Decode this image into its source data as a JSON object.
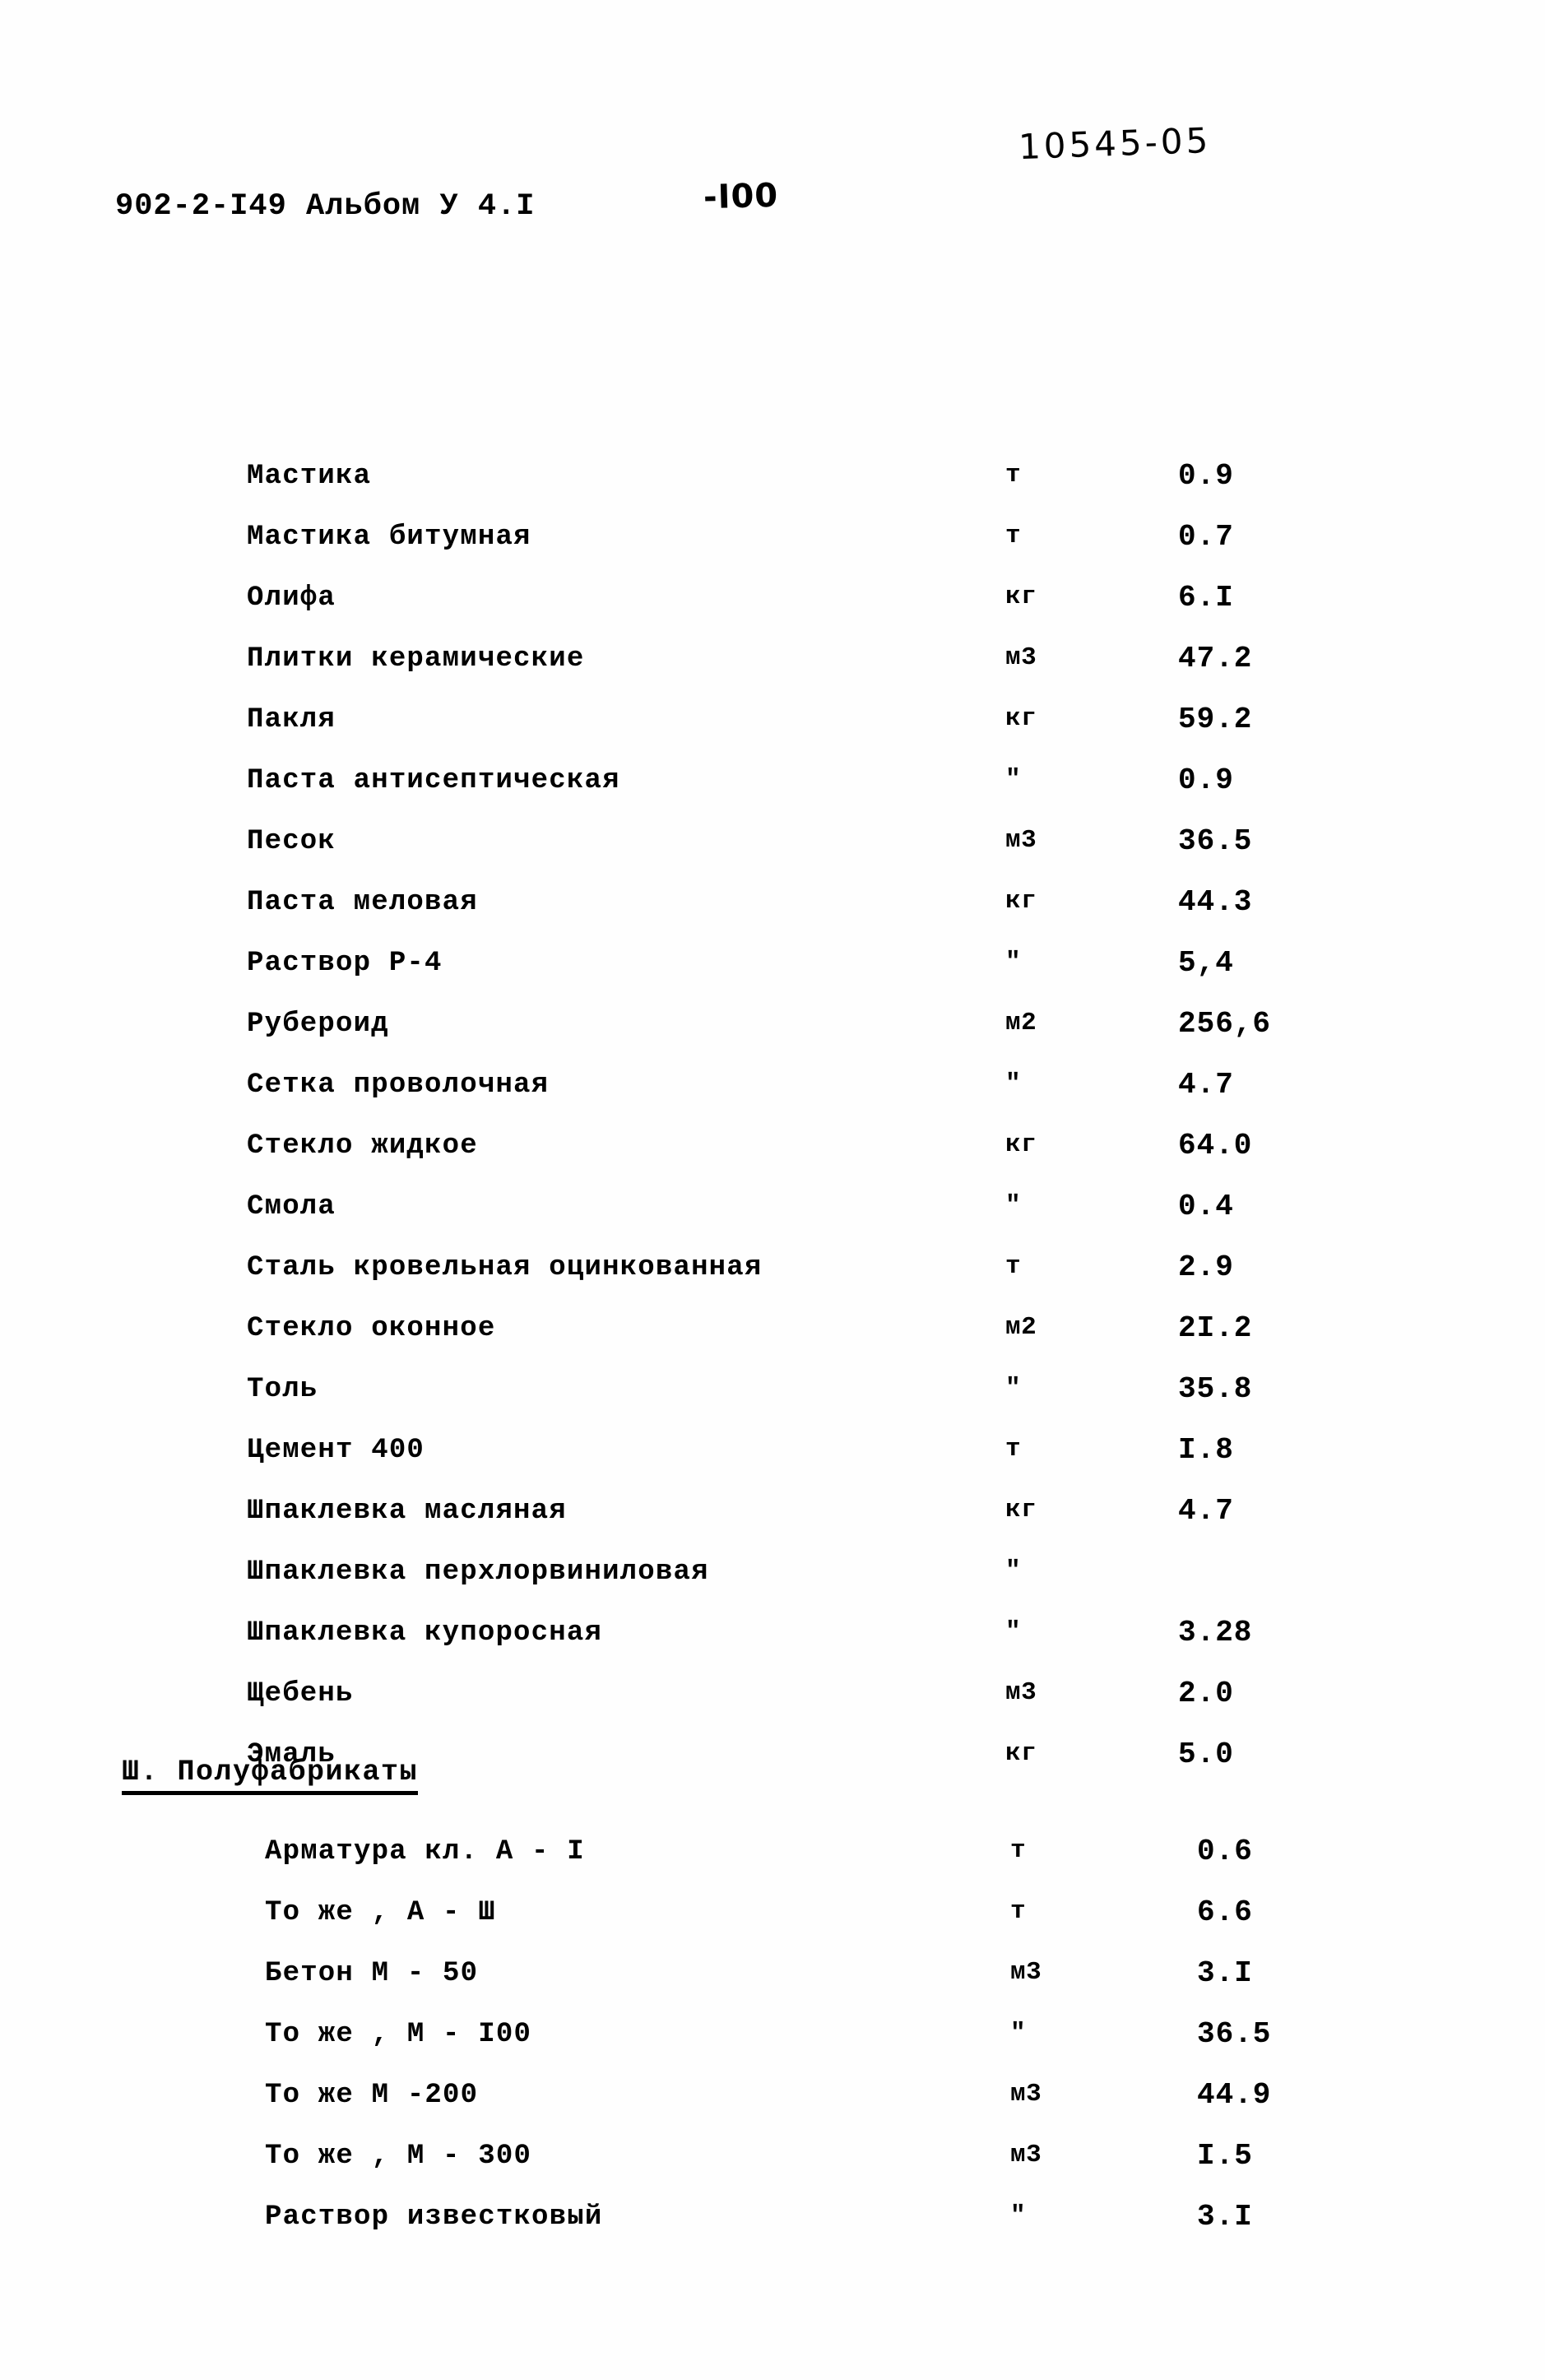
{
  "header": {
    "doc_code": "902-2-I49  Альбом У 4.I",
    "page_marker": "-I00",
    "stamp_number": "10545-05"
  },
  "materials_table": {
    "rows": [
      {
        "name": "Мастика",
        "unit": "т",
        "value": "0.9"
      },
      {
        "name": "Мастика битумная",
        "unit": "т",
        "value": "0.7"
      },
      {
        "name": "Олифа",
        "unit": "кг",
        "value": "6.I"
      },
      {
        "name": "Плитки керамические",
        "unit": "м3",
        "value": "47.2"
      },
      {
        "name": "Пакля",
        "unit": "кг",
        "value": "59.2"
      },
      {
        "name": "Паста антисептическая",
        "unit": "\"",
        "value": "0.9"
      },
      {
        "name": "Песок",
        "unit": "м3",
        "value": "36.5"
      },
      {
        "name": "Паста меловая",
        "unit": "кг",
        "value": "44.3"
      },
      {
        "name": "Раствор Р-4",
        "unit": "\"",
        "value": "5,4"
      },
      {
        "name": "Рубероид",
        "unit": "м2",
        "value": "256,6"
      },
      {
        "name": "Сетка проволочная",
        "unit": "\"",
        "value": "4.7"
      },
      {
        "name": "Стекло жидкое",
        "unit": "кг",
        "value": "64.0"
      },
      {
        "name": "Смола",
        "unit": "\"",
        "value": "0.4"
      },
      {
        "name": "Сталь кровельная оцинкованная",
        "unit": "т",
        "value": "2.9"
      },
      {
        "name": "Стекло оконное",
        "unit": "м2",
        "value": "2I.2"
      },
      {
        "name": "Толь",
        "unit": "\"",
        "value": "35.8"
      },
      {
        "name": "Цемент 400",
        "unit": "т",
        "value": "I.8"
      },
      {
        "name": "Шпаклевка масляная",
        "unit": "кг",
        "value": "4.7"
      },
      {
        "name": "Шпаклевка перхлорвиниловая",
        "unit": "\"",
        "value": ""
      },
      {
        "name": "Шпаклевка купоросная",
        "unit": "\"",
        "value": "3.28"
      },
      {
        "name": "Щебень",
        "unit": "м3",
        "value": "2.0"
      },
      {
        "name": "Эмаль",
        "unit": "кг",
        "value": "5.0"
      }
    ]
  },
  "section_semifinished": {
    "heading": "Ш. Полуфабрикаты"
  },
  "semifinished_table": {
    "rows": [
      {
        "name": "Арматура кл. А - I",
        "unit": "т",
        "value": "0.6"
      },
      {
        "name": "То же , А - Ш",
        "unit": "т",
        "value": "6.6"
      },
      {
        "name": "Бетон М - 50",
        "unit": "м3",
        "value": "3.I"
      },
      {
        "name": "То же , М - I00",
        "unit": "\"",
        "value": "36.5"
      },
      {
        "name": "То же  М -200",
        "unit": "м3",
        "value": "44.9"
      },
      {
        "name": "То же , М - 300",
        "unit": "м3",
        "value": "I.5"
      },
      {
        "name": "Раствор известковый",
        "unit": "\"",
        "value": "3.I"
      }
    ]
  }
}
